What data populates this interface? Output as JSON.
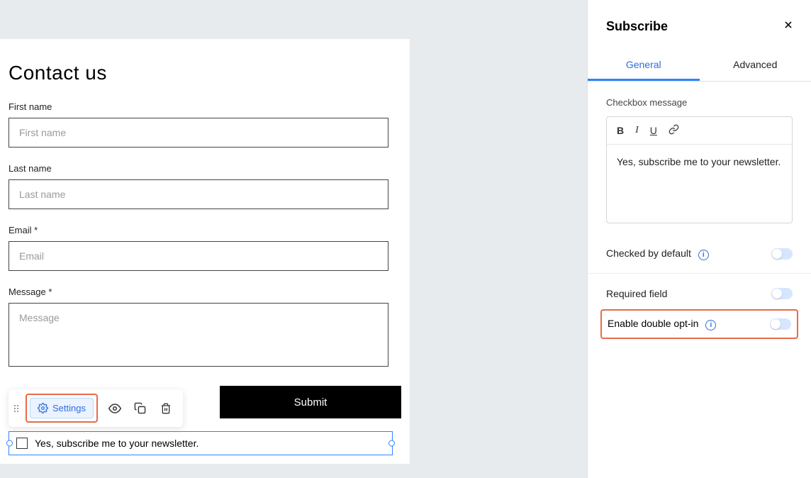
{
  "form": {
    "title": "Contact us",
    "fields": {
      "first_name": {
        "label": "First name",
        "placeholder": "First name"
      },
      "last_name": {
        "label": "Last name",
        "placeholder": "Last name"
      },
      "email": {
        "label": "Email *",
        "placeholder": "Email"
      },
      "message": {
        "label": "Message *",
        "placeholder": "Message"
      }
    },
    "submit_label": "Submit",
    "checkbox_text": "Yes, subscribe me to your newsletter."
  },
  "toolbar": {
    "settings_label": "Settings"
  },
  "panel": {
    "title": "Subscribe",
    "tabs": {
      "general": "General",
      "advanced": "Advanced"
    },
    "checkbox_message_label": "Checkbox message",
    "checkbox_message_value": "Yes, subscribe me to your newsletter.",
    "checked_by_default": "Checked by default",
    "required_field": "Required field",
    "enable_double_optin": "Enable double opt-in"
  }
}
